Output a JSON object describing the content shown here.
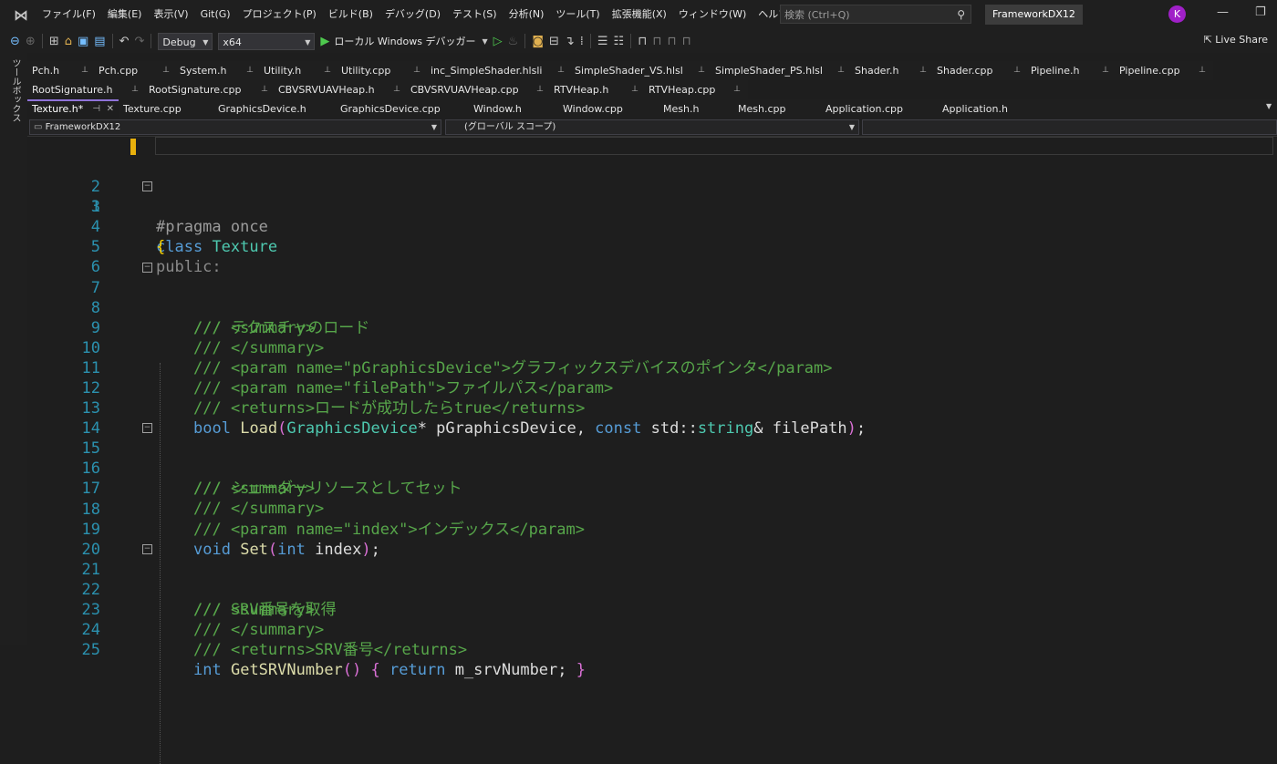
{
  "menubar": {
    "items": [
      "ファイル(F)",
      "編集(E)",
      "表示(V)",
      "Git(G)",
      "プロジェクト(P)",
      "ビルド(B)",
      "デバッグ(D)",
      "テスト(S)",
      "分析(N)",
      "ツール(T)",
      "拡張機能(X)",
      "ウィンドウ(W)",
      "ヘルプ(H)"
    ],
    "search_placeholder": "検索 (Ctrl+Q)",
    "solution_name": "FrameworkDX12",
    "avatar_initial": "K"
  },
  "toolbar": {
    "config": "Debug",
    "platform": "x64",
    "run_label": "ローカル Windows デバッガー",
    "live_share": "Live Share"
  },
  "toolbox_label": "ツールボックス",
  "tabs": {
    "row1": [
      "Pch.h",
      "Pch.cpp",
      "System.h",
      "Utility.h",
      "Utility.cpp",
      "inc_SimpleShader.hlsli",
      "SimpleShader_VS.hlsl",
      "SimpleShader_PS.hlsl",
      "Shader.h",
      "Shader.cpp",
      "Pipeline.h",
      "Pipeline.cpp"
    ],
    "row2": [
      "RootSignature.h",
      "RootSignature.cpp",
      "CBVSRVUAVHeap.h",
      "CBVSRVUAVHeap.cpp",
      "RTVHeap.h",
      "RTVHeap.cpp"
    ],
    "row3": [
      "Texture.h*",
      "Texture.cpp",
      "GraphicsDevice.h",
      "GraphicsDevice.cpp",
      "Window.h",
      "Window.cpp",
      "Mesh.h",
      "Mesh.cpp",
      "Application.cpp",
      "Application.h"
    ]
  },
  "navbar": {
    "project": "FrameworkDX12",
    "scope": "(グローバル スコープ)",
    "member": ""
  },
  "code": {
    "line_numbers": [
      "1",
      "2",
      "3",
      "4",
      "5",
      "6",
      "7",
      "8",
      "9",
      "10",
      "11",
      "12",
      "13",
      "14",
      "15",
      "16",
      "17",
      "18",
      "19",
      "20",
      "21",
      "22",
      "23",
      "24",
      "25"
    ],
    "l1": "#pragma once",
    "l3_kw": "class",
    "l3_name": "Texture",
    "l4": "{",
    "l5": "public:",
    "l7": "/// <summary>",
    "l8": "/// テクスチャのロード",
    "l9": "/// </summary>",
    "l10": "/// <param name=\"pGraphicsDevice\">グラフィックスデバイスのポインタ</param>",
    "l11": "/// <param name=\"filePath\">ファイルパス</param>",
    "l12": "/// <returns>ロードが成功したらtrue</returns>",
    "l13_bool": "bool",
    "l13_fn": "Load",
    "l13_open": "(",
    "l13_type": "GraphicsDevice",
    "l13_a": "* pGraphicsDevice, ",
    "l13_const": "const",
    "l13_std": "std",
    "l13_sep": "::",
    "l13_string": "string",
    "l13_b": "& filePath",
    "l13_close": ")",
    "l13_semi": ";",
    "l15": "/// <summary>",
    "l16": "/// シェーダーリソースとしてセット",
    "l17": "/// </summary>",
    "l18": "/// <param name=\"index\">インデックス</param>",
    "l19_void": "void",
    "l19_fn": "Set",
    "l19_open": "(",
    "l19_int": "int",
    "l19_arg": " index",
    "l19_close": ")",
    "l19_semi": ";",
    "l21": "/// <summary>",
    "l22": "/// SRV番号を取得",
    "l23": "/// </summary>",
    "l24": "/// <returns>SRV番号</returns>",
    "l25_int": "int",
    "l25_fn": "GetSRVNumber",
    "l25_paren": "()",
    "l25_ob": "{",
    "l25_ret": "return",
    "l25_var": " m_srvNumber; ",
    "l25_cb": "}"
  }
}
